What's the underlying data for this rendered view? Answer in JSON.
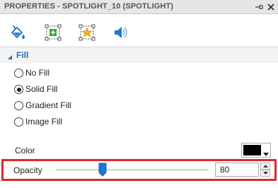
{
  "panel": {
    "title": "PROPERTIES - SPOTLIGHT_10 (SPOTLIGHT)",
    "pin_icon": "pin-icon",
    "close_icon": "close-icon"
  },
  "toolbar": {
    "tools": [
      {
        "name": "fill-bucket-icon"
      },
      {
        "name": "resize-icon"
      },
      {
        "name": "star-effect-icon"
      },
      {
        "name": "audio-icon"
      }
    ]
  },
  "fill": {
    "section_label": "Fill",
    "options": [
      {
        "label": "No Fill",
        "checked": false
      },
      {
        "label": "Solid Fill",
        "checked": true
      },
      {
        "label": "Gradient Fill",
        "checked": false
      },
      {
        "label": "Image Fill",
        "checked": false
      }
    ],
    "color_label": "Color",
    "color_value": "#000000"
  },
  "opacity": {
    "label": "Opacity",
    "value": "80"
  },
  "colors": {
    "accent": "#2a6fb5",
    "highlight_border": "#e0262d",
    "slider_thumb": "#1f78d1"
  }
}
